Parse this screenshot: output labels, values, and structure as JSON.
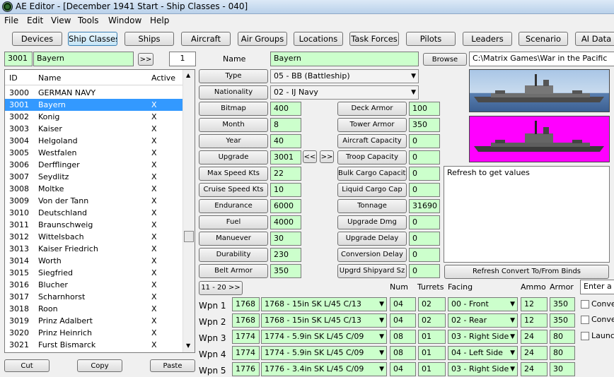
{
  "window": {
    "title": "AE Editor - [December 1941 Start - Ship Classes - 040]"
  },
  "menu": [
    "File",
    "Edit",
    "View",
    "Tools",
    "Window",
    "Help"
  ],
  "toolbar": [
    "Devices",
    "Ship Classes",
    "Ships",
    "Aircraft",
    "Air Groups",
    "Locations",
    "Task Forces",
    "Pilots",
    "Leaders",
    "Scenario",
    "AI Data"
  ],
  "active_tab": "Ship Classes",
  "nav": {
    "id": "3001",
    "name": "Bayern",
    "next": ">>",
    "step": "1"
  },
  "list": {
    "headers": [
      "ID",
      "Name",
      "Active"
    ],
    "rows": [
      {
        "id": "3000",
        "name": "GERMAN NAVY",
        "active": ""
      },
      {
        "id": "3001",
        "name": "Bayern",
        "active": "X"
      },
      {
        "id": "3002",
        "name": "Konig",
        "active": "X"
      },
      {
        "id": "3003",
        "name": "Kaiser",
        "active": "X"
      },
      {
        "id": "3004",
        "name": "Helgoland",
        "active": "X"
      },
      {
        "id": "3005",
        "name": "Westfalen",
        "active": "X"
      },
      {
        "id": "3006",
        "name": "Derfflinger",
        "active": "X"
      },
      {
        "id": "3007",
        "name": "Seydlitz",
        "active": "X"
      },
      {
        "id": "3008",
        "name": "Moltke",
        "active": "X"
      },
      {
        "id": "3009",
        "name": "Von der Tann",
        "active": "X"
      },
      {
        "id": "3010",
        "name": "Deutschland",
        "active": "X"
      },
      {
        "id": "3011",
        "name": "Braunschweig",
        "active": "X"
      },
      {
        "id": "3012",
        "name": "Wittelsbach",
        "active": "X"
      },
      {
        "id": "3013",
        "name": "Kaiser Friedrich",
        "active": "X"
      },
      {
        "id": "3014",
        "name": "Worth",
        "active": "X"
      },
      {
        "id": "3015",
        "name": "Siegfried",
        "active": "X"
      },
      {
        "id": "3016",
        "name": "Blucher",
        "active": "X"
      },
      {
        "id": "3017",
        "name": "Scharnhorst",
        "active": "X"
      },
      {
        "id": "3018",
        "name": "Roon",
        "active": "X"
      },
      {
        "id": "3019",
        "name": "Prinz Adalbert",
        "active": "X"
      },
      {
        "id": "3020",
        "name": "Prinz Heinrich",
        "active": "X"
      },
      {
        "id": "3021",
        "name": "Furst Bismarck",
        "active": "X"
      }
    ],
    "selected_index": 1
  },
  "bottom_buttons": {
    "cut": "Cut",
    "copy": "Copy",
    "paste": "Paste"
  },
  "form": {
    "name_label": "Name",
    "name": "Bayern",
    "browse": "Browse",
    "path": "C:\\Matrix Games\\War in the Pacific",
    "type_label": "Type",
    "type": "05 - BB (Battleship)",
    "nationality_label": "Nationality",
    "nationality": "02 - IJ Navy",
    "left": [
      {
        "label": "Bitmap",
        "value": "400"
      },
      {
        "label": "Month",
        "value": "8"
      },
      {
        "label": "Year",
        "value": "40"
      },
      {
        "label": "Upgrade",
        "value": "3001"
      },
      {
        "label": "Max Speed Kts",
        "value": "22"
      },
      {
        "label": "Cruise Speed Kts",
        "value": "10"
      },
      {
        "label": "Endurance",
        "value": "6000"
      },
      {
        "label": "Fuel",
        "value": "4000"
      },
      {
        "label": "Manuever",
        "value": "30"
      },
      {
        "label": "Durability",
        "value": "230"
      },
      {
        "label": "Belt Armor",
        "value": "350"
      }
    ],
    "upgrade_prev": "<<",
    "upgrade_next": ">>",
    "right": [
      {
        "label": "Deck Armor",
        "value": "100"
      },
      {
        "label": "Tower Armor",
        "value": "350"
      },
      {
        "label": "Aircraft Capacity",
        "value": "0"
      },
      {
        "label": "Troop Capacity",
        "value": "0"
      },
      {
        "label": "Bulk Cargo Capacity",
        "value": "0"
      },
      {
        "label": "Liquid Cargo Cap",
        "value": "0"
      },
      {
        "label": "Tonnage",
        "value": "31690"
      },
      {
        "label": "Upgrade Dmg",
        "value": "0"
      },
      {
        "label": "Upgrade Delay",
        "value": "0"
      },
      {
        "label": "Conversion Delay",
        "value": "0"
      },
      {
        "label": "Upgrd Shipyard Sz",
        "value": "0"
      }
    ],
    "notes": "Refresh to get values",
    "refresh_button": "Refresh Convert To/From Binds",
    "page_button": "11 - 20 >>"
  },
  "weapons": {
    "headers": {
      "num": "Num",
      "turrets": "Turrets",
      "facing": "Facing",
      "ammo": "Ammo",
      "armor": "Armor"
    },
    "enter_placeholder": "Enter a v",
    "convert_labels": [
      "Convert",
      "Convert"
    ],
    "launch_label": "Launch I",
    "rows": [
      {
        "label": "Wpn 1",
        "id": "1768",
        "device": "1768 - 15in SK L/45 C/13",
        "num": "04",
        "turrets": "02",
        "facing": "00 - Front",
        "ammo": "12",
        "armor": "350"
      },
      {
        "label": "Wpn 2",
        "id": "1768",
        "device": "1768 - 15in SK L/45 C/13",
        "num": "04",
        "turrets": "02",
        "facing": "02 - Rear",
        "ammo": "12",
        "armor": "350"
      },
      {
        "label": "Wpn 3",
        "id": "1774",
        "device": "1774 - 5.9in SK L/45 C/09",
        "num": "08",
        "turrets": "01",
        "facing": "03 - Right Side",
        "ammo": "24",
        "armor": "80"
      },
      {
        "label": "Wpn 4",
        "id": "1774",
        "device": "1774 - 5.9in SK L/45 C/09",
        "num": "08",
        "turrets": "01",
        "facing": "04 - Left Side",
        "ammo": "24",
        "armor": "80"
      },
      {
        "label": "Wpn 5",
        "id": "1776",
        "device": "1776 - 3.4in SK L/45 C/09",
        "num": "04",
        "turrets": "01",
        "facing": "03 - Right Side",
        "ammo": "24",
        "armor": "30"
      }
    ]
  },
  "colors": {
    "field": "#ccffcc",
    "selection": "#3399ff",
    "magenta": "#ff00ff"
  }
}
